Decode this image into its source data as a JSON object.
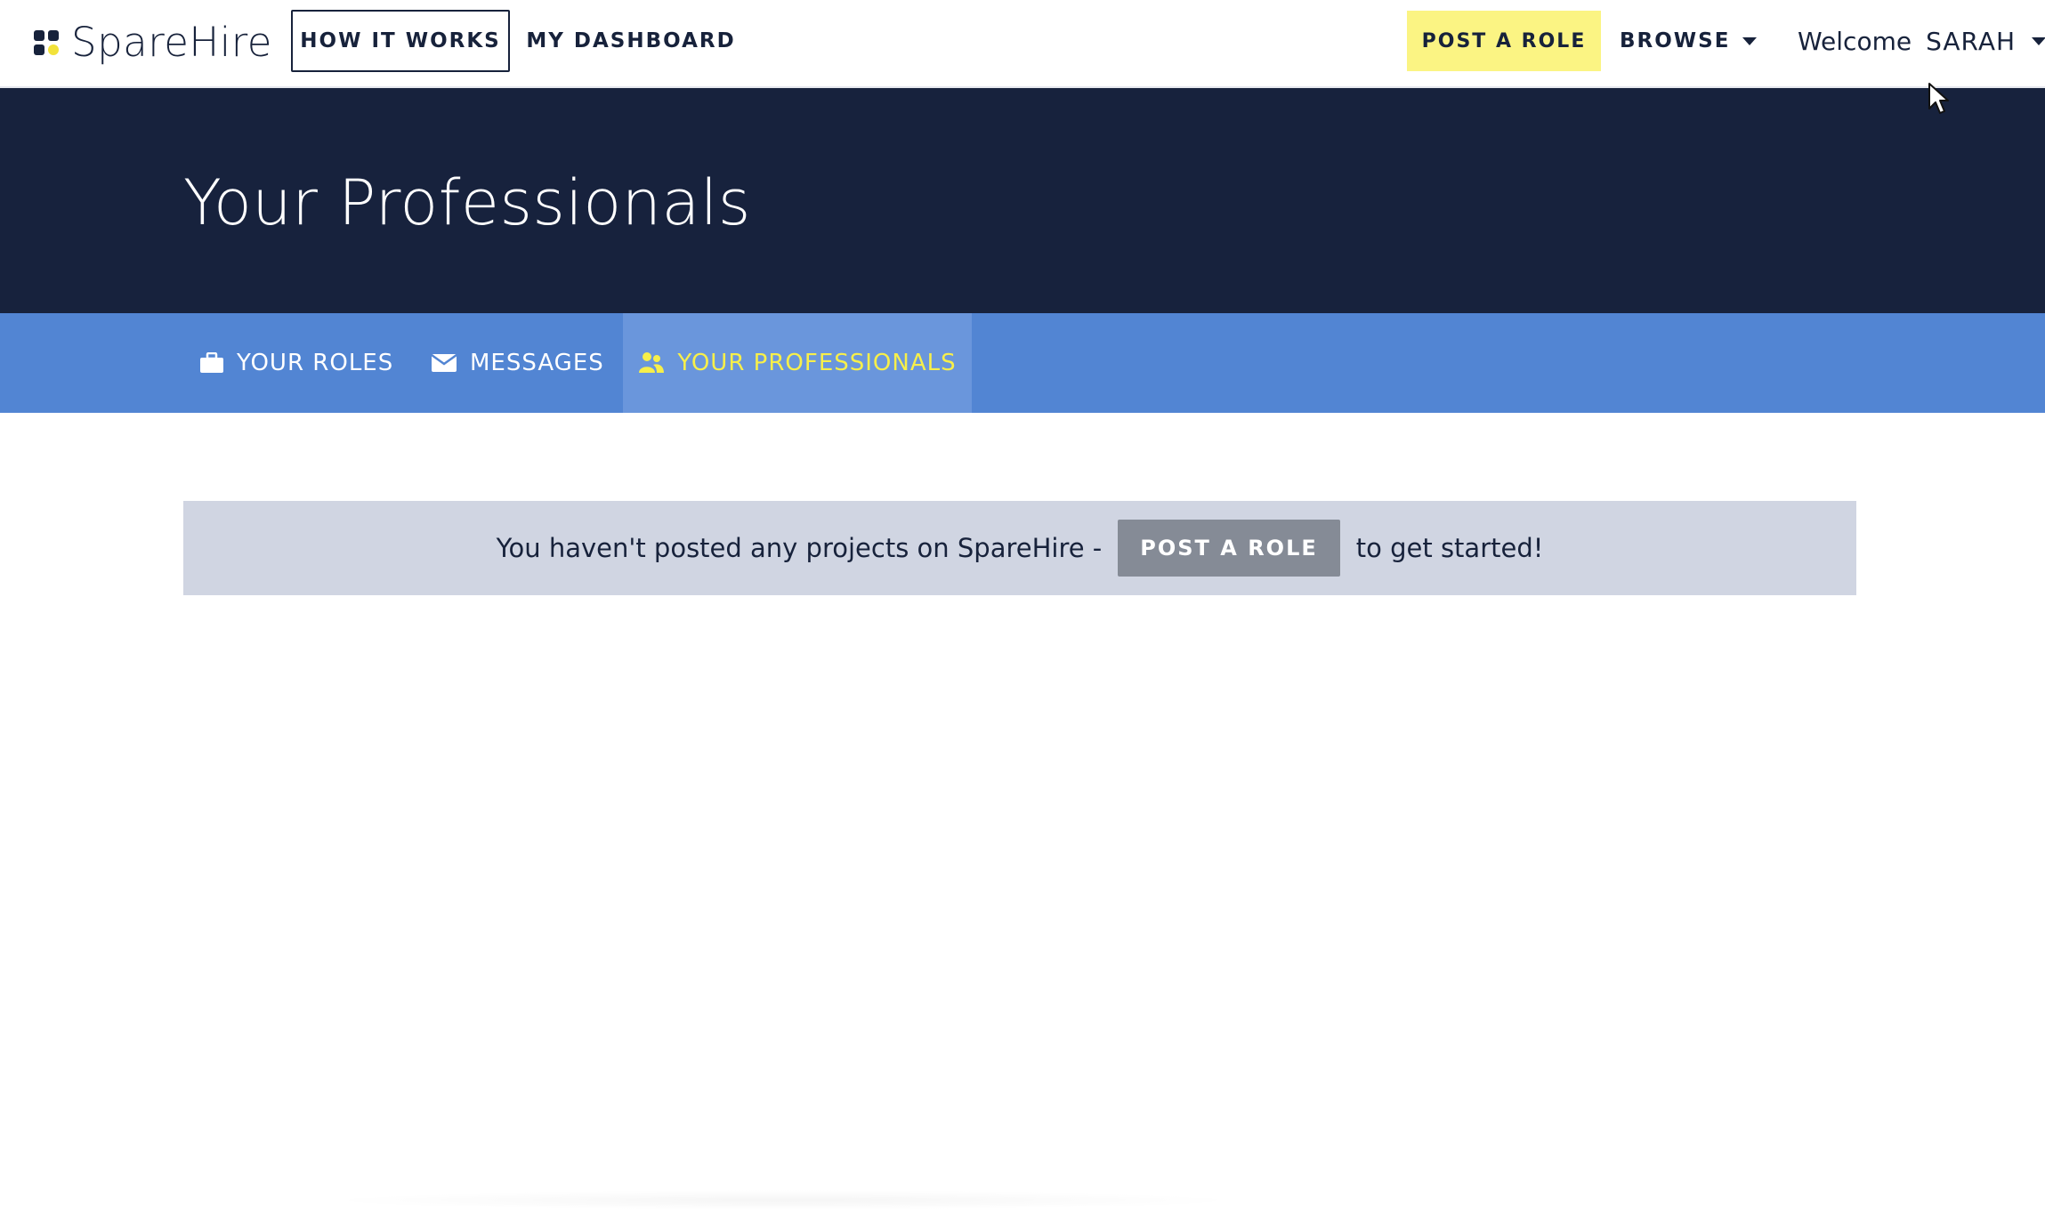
{
  "brand": {
    "name": "SpareHire",
    "accent": "#f2e23a"
  },
  "nav": {
    "how_it_works": "HOW IT WORKS",
    "my_dashboard": "MY DASHBOARD",
    "post_a_role": "POST A ROLE",
    "browse": "BROWSE",
    "welcome": "Welcome",
    "user_name": "SARAH"
  },
  "hero": {
    "title": "Your Professionals",
    "background": "#17223d"
  },
  "tabs": [
    {
      "label": "YOUR ROLES",
      "icon": "briefcase-icon",
      "active": false
    },
    {
      "label": "MESSAGES",
      "icon": "envelope-icon",
      "active": false
    },
    {
      "label": "YOUR PROFESSIONALS",
      "icon": "users-icon",
      "active": true
    }
  ],
  "tab_colors": {
    "bar": "#5285d3",
    "active_bg": "#6a96dc",
    "active_text": "#f7ef4a"
  },
  "alert": {
    "text_before": "You haven't posted any projects on SpareHire -",
    "button_label": "POST A ROLE",
    "text_after": "to get started!"
  }
}
